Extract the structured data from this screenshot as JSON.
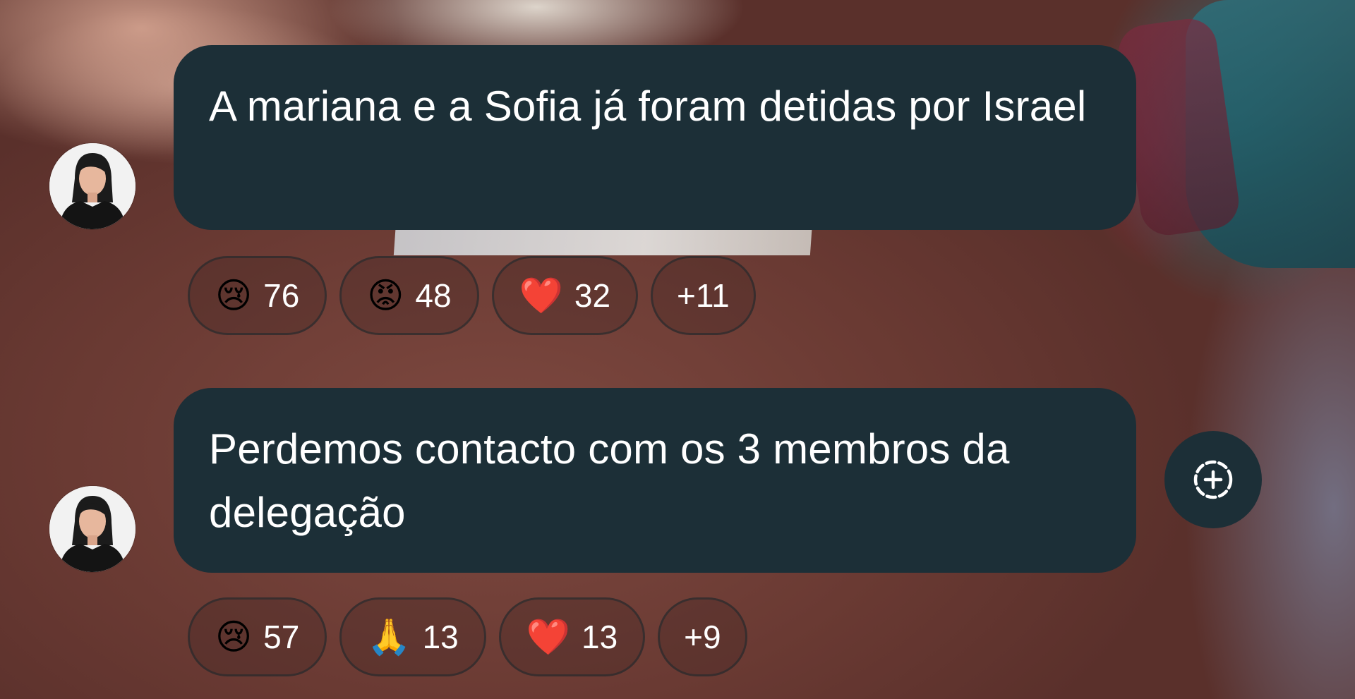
{
  "messages": [
    {
      "text": "A mariana e a Sofia já foram detidas por Israel",
      "reactions": [
        {
          "emoji": "😢",
          "count": "76"
        },
        {
          "emoji": "😡",
          "count": "48"
        },
        {
          "emoji": "❤️",
          "count": "32"
        }
      ],
      "more": "+11"
    },
    {
      "text": "Perdemos contacto com os 3 membros da delegação",
      "reactions": [
        {
          "emoji": "😢",
          "count": "57"
        },
        {
          "emoji": "🙏",
          "count": "13"
        },
        {
          "emoji": "❤️",
          "count": "13"
        }
      ],
      "more": "+9"
    }
  ],
  "icons": {
    "add_reaction": "add-reaction-icon"
  },
  "colors": {
    "bubble": "#1c2f37",
    "text": "#ffffff"
  }
}
